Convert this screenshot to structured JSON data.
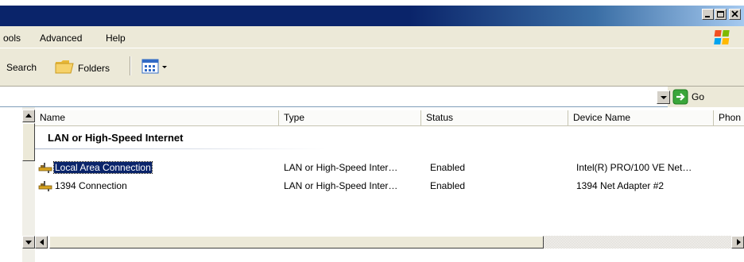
{
  "menu": {
    "items": [
      {
        "label": "ools"
      },
      {
        "label": "Advanced"
      },
      {
        "label": "Help"
      }
    ]
  },
  "toolbar": {
    "search_label": "Search",
    "folders_label": "Folders"
  },
  "address": {
    "go_label": "Go"
  },
  "columns": [
    "Name",
    "Type",
    "Status",
    "Device Name",
    "Phon"
  ],
  "group": {
    "title": "LAN or High-Speed Internet"
  },
  "rows": [
    {
      "name": "Local Area Connection",
      "type": "LAN or High-Speed Inter…",
      "status": "Enabled",
      "device": "Intel(R) PRO/100 VE Net…",
      "selected": true
    },
    {
      "name": "1394 Connection",
      "type": "LAN or High-Speed Inter…",
      "status": "Enabled",
      "device": "1394 Net Adapter #2",
      "selected": false
    }
  ],
  "colors": {
    "title_bar": "#0a246a",
    "chrome": "#ece9d8",
    "selection": "#0a246a"
  },
  "icons": [
    "minimize-icon",
    "maximize-icon",
    "close-icon",
    "windows-logo-icon",
    "folders-icon",
    "views-icon",
    "go-arrow-icon",
    "network-connection-icon"
  ]
}
